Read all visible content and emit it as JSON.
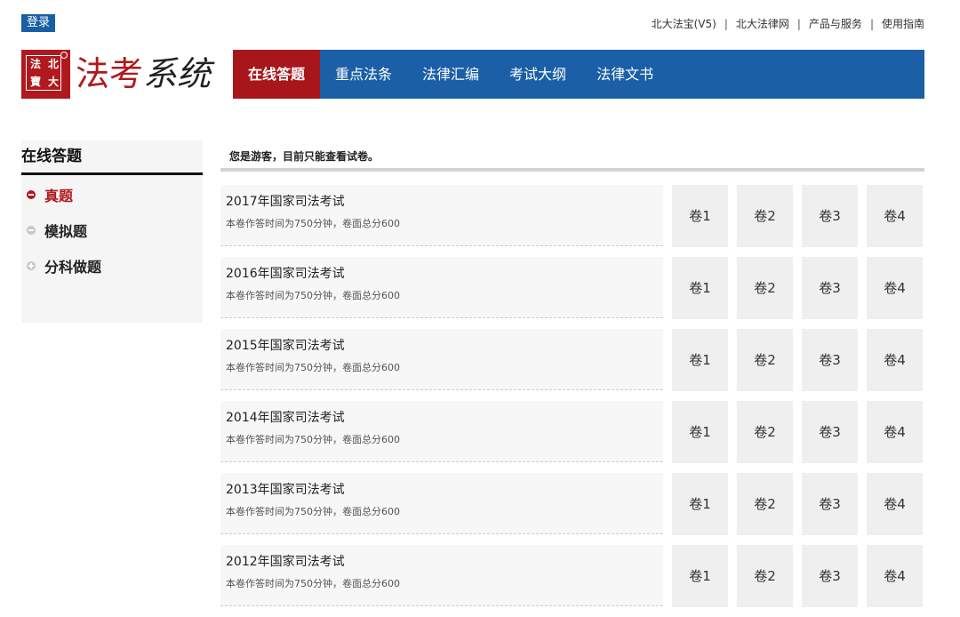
{
  "topbar": {
    "login_label": "登录",
    "links": [
      "北大法宝(V5)",
      "北大法律网",
      "产品与服务",
      "使用指南"
    ],
    "separator": "|"
  },
  "logo": {
    "seal_chars": [
      "法",
      "北",
      "寶",
      "大"
    ],
    "text_red": "法考",
    "text_dark": "系统"
  },
  "nav": {
    "items": [
      "在线答题",
      "重点法条",
      "法律汇编",
      "考试大纲",
      "法律文书"
    ],
    "active_index": 0
  },
  "sidebar": {
    "title": "在线答题",
    "items": [
      {
        "label": "真题",
        "icon": "minus-circle-icon",
        "active": true
      },
      {
        "label": "模拟题",
        "icon": "minus-circle-icon",
        "active": false
      },
      {
        "label": "分科做题",
        "icon": "plus-circle-icon",
        "active": false
      }
    ]
  },
  "main": {
    "notice": "您是游客，目前只能查看试卷。",
    "exams": [
      {
        "title": "2017年国家司法考试",
        "subtitle": "本卷作答时间为750分钟，卷面总分600",
        "volumes": [
          "卷1",
          "卷2",
          "卷3",
          "卷4"
        ]
      },
      {
        "title": "2016年国家司法考试",
        "subtitle": "本卷作答时间为750分钟，卷面总分600",
        "volumes": [
          "卷1",
          "卷2",
          "卷3",
          "卷4"
        ]
      },
      {
        "title": "2015年国家司法考试",
        "subtitle": "本卷作答时间为750分钟，卷面总分600",
        "volumes": [
          "卷1",
          "卷2",
          "卷3",
          "卷4"
        ]
      },
      {
        "title": "2014年国家司法考试",
        "subtitle": "本卷作答时间为750分钟，卷面总分600",
        "volumes": [
          "卷1",
          "卷2",
          "卷3",
          "卷4"
        ]
      },
      {
        "title": "2013年国家司法考试",
        "subtitle": "本卷作答时间为750分钟，卷面总分600",
        "volumes": [
          "卷1",
          "卷2",
          "卷3",
          "卷4"
        ]
      },
      {
        "title": "2012年国家司法考试",
        "subtitle": "本卷作答时间为750分钟，卷面总分600",
        "volumes": [
          "卷1",
          "卷2",
          "卷3",
          "卷4"
        ]
      }
    ]
  },
  "colors": {
    "brand_red": "#b0191e",
    "nav_blue": "#1b5fa6"
  }
}
